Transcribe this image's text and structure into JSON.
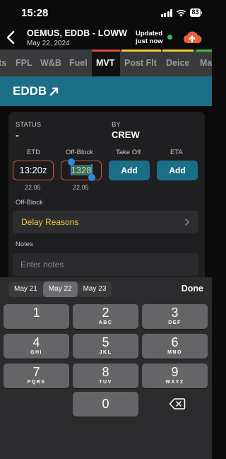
{
  "status_bar": {
    "time": "15:28",
    "battery": "83"
  },
  "header": {
    "title": "OEMUS, EDDB - LOWW",
    "date": "May 22, 2024",
    "updated_line1": "Updated",
    "updated_line2": "just now"
  },
  "tabs": [
    {
      "label": "ts",
      "underline": ""
    },
    {
      "label": "FPL",
      "underline": ""
    },
    {
      "label": "W&B",
      "underline": ""
    },
    {
      "label": "Fuel",
      "underline": ""
    },
    {
      "label": "MVT",
      "underline": "#d94a3d",
      "active": true
    },
    {
      "label": "Post Flt",
      "underline": "#f0c83c"
    },
    {
      "label": "Deice",
      "underline": "#f0c83c"
    },
    {
      "label": "Ma",
      "underline": "#3fbf4a"
    }
  ],
  "airport": {
    "code": "EDDB"
  },
  "movement": {
    "status_label": "STATUS",
    "status_value": "-",
    "by_label": "BY",
    "by_value": "CREW",
    "etd_label": "ETD",
    "etd_value": "13:20z",
    "etd_date": "22.05",
    "offblock_label": "Off-Block",
    "offblock_value": "1328",
    "offblock_date": "22.05",
    "takeoff_label": "Take Off",
    "takeoff_button": "Add",
    "eta_label": "ETA",
    "eta_button": "Add",
    "offblock_section_label": "Off-Block",
    "delay_reasons": "Delay Reasons",
    "notes_label": "Notes",
    "notes_placeholder": "Enter notes"
  },
  "keyboard": {
    "dates": [
      "May 21",
      "May 22",
      "May 23"
    ],
    "selected_date": "May 22",
    "done": "Done",
    "keys": [
      {
        "num": "1",
        "letters": ""
      },
      {
        "num": "2",
        "letters": "ABC"
      },
      {
        "num": "3",
        "letters": "DEF"
      },
      {
        "num": "4",
        "letters": "GHI"
      },
      {
        "num": "5",
        "letters": "JKL"
      },
      {
        "num": "6",
        "letters": "MNO"
      },
      {
        "num": "7",
        "letters": "PQRS"
      },
      {
        "num": "8",
        "letters": "TUV"
      },
      {
        "num": "9",
        "letters": "WXYZ"
      },
      {
        "num": "0",
        "letters": ""
      }
    ]
  },
  "colors": {
    "accent_teal": "#1a6e86",
    "delay_yellow": "#f3cc3b",
    "field_border_orange": "#d05a36",
    "online_green": "#2fbf4a",
    "cloud_orange": "#e8613c"
  }
}
